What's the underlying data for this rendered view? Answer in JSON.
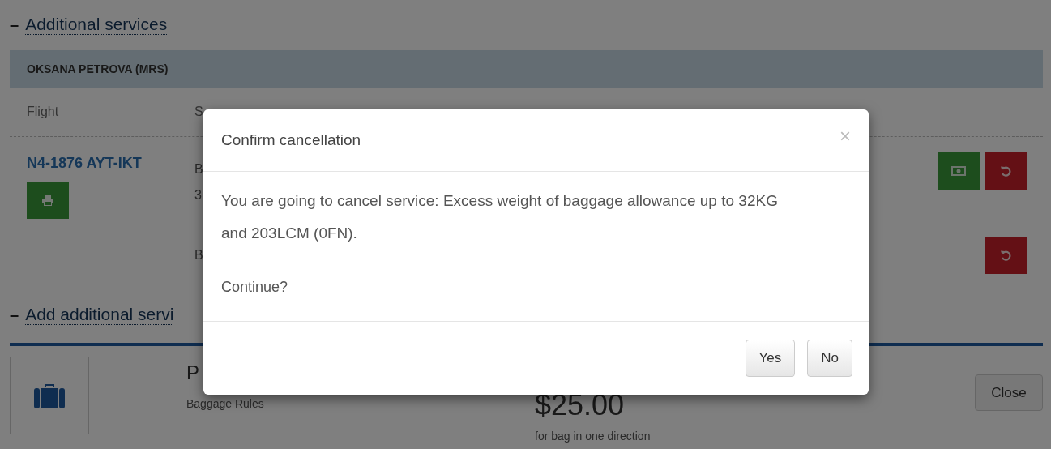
{
  "additional_services": {
    "toggle": "–",
    "title": "Additional services",
    "passenger": "OKSANA PETROVA (MRS)",
    "columns": [
      "Flight",
      "S"
    ],
    "flight": "N4-1876 AYT-IKT",
    "services": [
      {
        "lines": [
          "B",
          "3"
        ],
        "actions": [
          {
            "kind": "pay"
          },
          {
            "kind": "cancel"
          }
        ]
      },
      {
        "lines": [
          "B"
        ],
        "actions": [
          {
            "kind": "cancel"
          }
        ]
      }
    ]
  },
  "add_services": {
    "toggle": "–",
    "title": "Add additional servi",
    "card": {
      "name": "P",
      "rules": "Baggage Rules",
      "price": "$25.00",
      "price_note": "for bag in one direction",
      "button": "Close"
    }
  },
  "dialog": {
    "title": "Confirm cancellation",
    "close": "×",
    "message": "You are going to cancel service: Excess weight of baggage allowance up to 32KG and 203LCM (0FN).",
    "question": "Continue?",
    "buttons": [
      "Yes",
      "No"
    ]
  }
}
